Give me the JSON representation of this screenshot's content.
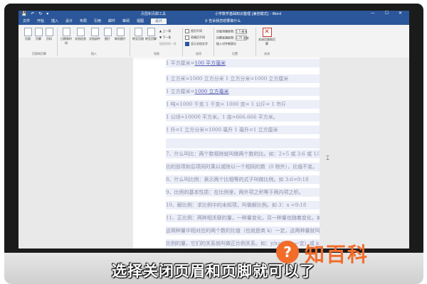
{
  "titlebar": {
    "quick_access": "💾 ↶ ↻ ▾",
    "context_tools": "页眉和页脚工具",
    "doc_title": "小学数学基础知识整理 [兼容模式] - Word",
    "window_controls": "— ☐ ✕"
  },
  "tabs": [
    {
      "label": "文件"
    },
    {
      "label": "开始"
    },
    {
      "label": "插入"
    },
    {
      "label": "设计"
    },
    {
      "label": "布局"
    },
    {
      "label": "引用"
    },
    {
      "label": "邮件"
    },
    {
      "label": "审阅"
    },
    {
      "label": "视图"
    },
    {
      "label": "设计",
      "active": true
    }
  ],
  "tell_me": "♀ 告诉我您想要做什么",
  "ribbon": {
    "header_footer_group": {
      "buttons": [
        "页眉",
        "页脚",
        "页码"
      ],
      "label": "页眉和页脚"
    },
    "insert_group": {
      "buttons": [
        "日期和时间",
        "文档信息",
        "文档部件",
        "图片",
        "联机图片"
      ],
      "label": "插入"
    },
    "nav_group": {
      "buttons": [
        "转至页眉",
        "转至页脚"
      ],
      "prev": "上一条",
      "next": "下一条",
      "link": "链接到前一条",
      "label": "导航"
    },
    "options_group": {
      "first_page": "首页不同",
      "odd_even": "奇偶页不同",
      "show_text": "显示文档文字",
      "label": "选项"
    },
    "position_group": {
      "header_top_label": "页眉顶端距离:",
      "header_top_value": "1.5 厘米",
      "footer_bottom_label": "页脚底端距离:",
      "footer_bottom_value": "1.75 厘米",
      "insert_align": "插入对齐制表位",
      "label": "位置"
    },
    "close_group": {
      "button": "关闭页眉和页脚",
      "label": "关闭"
    }
  },
  "document": {
    "lines": [
      {
        "text": "1 平方厘米=",
        "underlined": "100 平方毫米"
      },
      {
        "text": "1 立方米=1000 立方分米 1 立方分米=1000 立方厘米"
      },
      {
        "text": "1 立方厘米=",
        "underlined": "1000 立方毫米"
      },
      {
        "text": "1 吨=1000 千克 1 千克= 1000 克= 1 公斤= 1 市斤"
      },
      {
        "text": "1 公顷=10000 平方米。1 亩=666.666 平方米。"
      },
      {
        "text": "1 升=1 立方分米=1000 毫升 1 毫升=1 立方厘米"
      },
      {
        "text": ""
      },
      {
        "text": "7、什么叫比：两个数相除就叫做两个数的比。如：2÷5 或 3:6 或 1/3"
      },
      {
        "text": "比的前项和后项同时乘以或除以一个相同的数（0 除外），比值不变。"
      },
      {
        "text": "8、什么叫比例：表示两个比相等的式子叫做比例。如 3:6=9:18"
      },
      {
        "text": "9、比例的基本性质：在比例里，两外项之积等于两内项之积。"
      },
      {
        "text": "10、解比例：求比例中的未知项，叫做解比例。如 3：x =9:18"
      },
      {
        "text": "11、正比例：两种相关联的量，一种量变化，另一种量也随着变化，如果"
      },
      {
        "text": "这两种量中相对应的两个数的比值（也就是商 k）一定，这两种量就叫做正"
      },
      {
        "text": "比例的量，它们的关系就叫做正比例关系。如：y/x=k（k 一定）或 kx=y"
      }
    ]
  },
  "logo": {
    "symbol": "?",
    "text": "知百科"
  },
  "subtitle": "选择关闭页眉和页脚就可以了"
}
